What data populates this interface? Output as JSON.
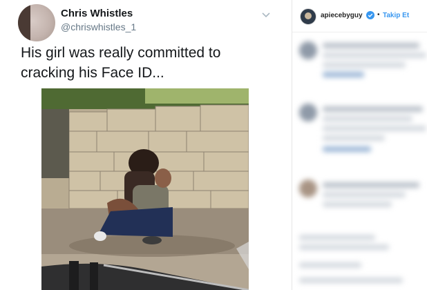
{
  "tweet": {
    "display_name": "Chris Whistles",
    "handle": "@chriswhistles_1",
    "text_line1": "His girl was really committed to",
    "text_line2": "cracking his Face ID...",
    "menu_icon": "chevron-down-icon"
  },
  "instagram": {
    "username": "apiecebyguy",
    "separator": "•",
    "follow_label": "Takip Et",
    "verified_icon": "verified-badge-icon",
    "accent_color": "#3897f0"
  }
}
